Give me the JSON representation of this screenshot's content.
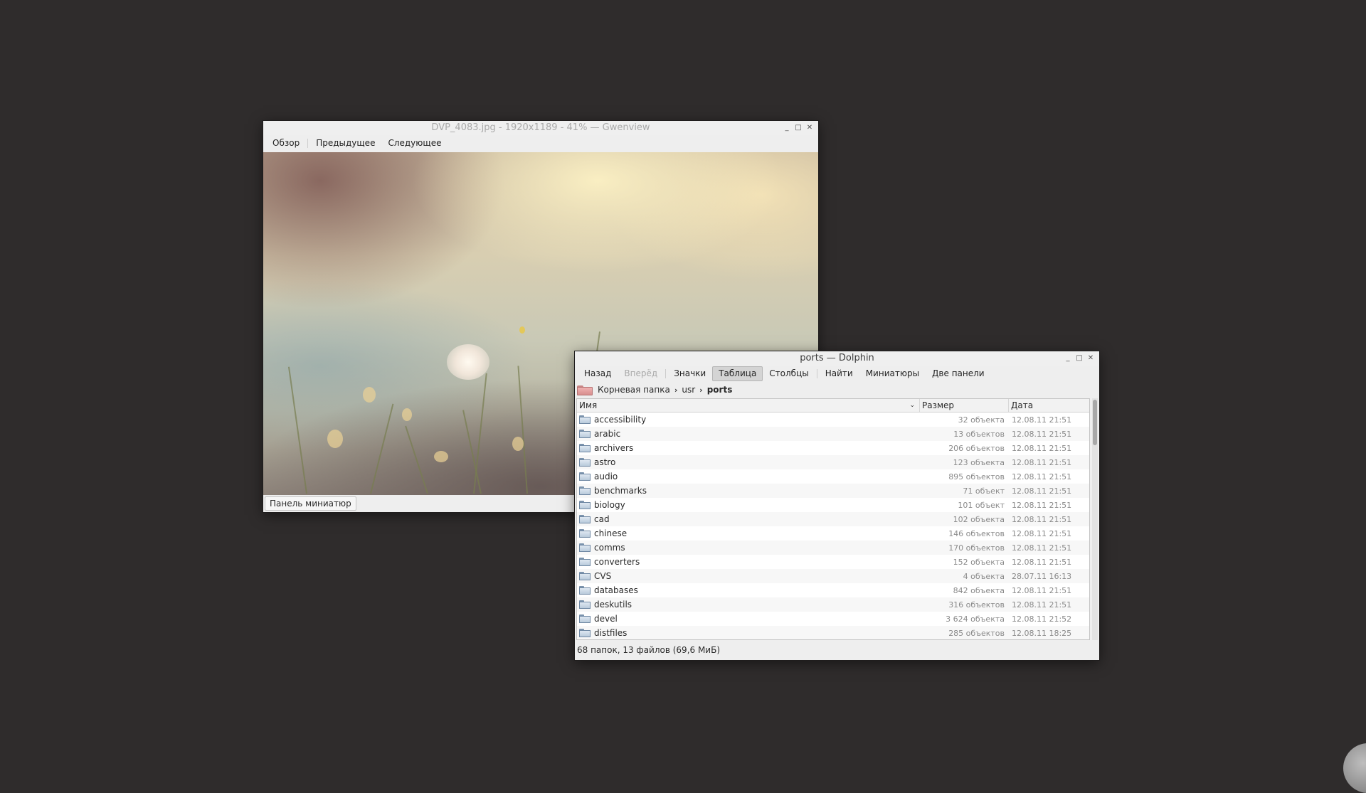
{
  "gwenview": {
    "title": "DVP_4083.jpg - 1920x1189 - 41% — Gwenview",
    "toolbar": [
      {
        "label": "Обзор"
      },
      {
        "label": "Предыдущее"
      },
      {
        "label": "Следующее"
      }
    ],
    "thumbnail_bar_button": "Панель миниатюр"
  },
  "dolphin": {
    "title": "ports — Dolphin",
    "toolbar": {
      "back": "Назад",
      "forward": "Вперёд",
      "icons": "Значки",
      "details": "Таблица",
      "columns": "Столбцы",
      "find": "Найти",
      "preview": "Миниатюры",
      "split": "Две панели"
    },
    "breadcrumb": {
      "root": "Корневая папка",
      "usr": "usr",
      "current": "ports"
    },
    "columns": {
      "name": "Имя",
      "size": "Размер",
      "date": "Дата"
    },
    "files": [
      {
        "name": "accessibility",
        "size": "32 объекта",
        "date": "12.08.11 21:51"
      },
      {
        "name": "arabic",
        "size": "13 объектов",
        "date": "12.08.11 21:51"
      },
      {
        "name": "archivers",
        "size": "206 объектов",
        "date": "12.08.11 21:51"
      },
      {
        "name": "astro",
        "size": "123 объекта",
        "date": "12.08.11 21:51"
      },
      {
        "name": "audio",
        "size": "895 объектов",
        "date": "12.08.11 21:51"
      },
      {
        "name": "benchmarks",
        "size": "71 объект",
        "date": "12.08.11 21:51"
      },
      {
        "name": "biology",
        "size": "101 объект",
        "date": "12.08.11 21:51"
      },
      {
        "name": "cad",
        "size": "102 объекта",
        "date": "12.08.11 21:51"
      },
      {
        "name": "chinese",
        "size": "146 объектов",
        "date": "12.08.11 21:51"
      },
      {
        "name": "comms",
        "size": "170 объектов",
        "date": "12.08.11 21:51"
      },
      {
        "name": "converters",
        "size": "152 объекта",
        "date": "12.08.11 21:51"
      },
      {
        "name": "CVS",
        "size": "4 объекта",
        "date": "28.07.11 16:13"
      },
      {
        "name": "databases",
        "size": "842 объекта",
        "date": "12.08.11 21:51"
      },
      {
        "name": "deskutils",
        "size": "316 объектов",
        "date": "12.08.11 21:51"
      },
      {
        "name": "devel",
        "size": "3 624 объекта",
        "date": "12.08.11 21:52"
      },
      {
        "name": "distfiles",
        "size": "285 объектов",
        "date": "12.08.11 18:25"
      }
    ],
    "status": "68 папок, 13 файлов (69,6 МиБ)"
  },
  "colors": {
    "desktop": "#2f2c2c",
    "window": "#eeeeee",
    "folder": "#b9cadb"
  }
}
